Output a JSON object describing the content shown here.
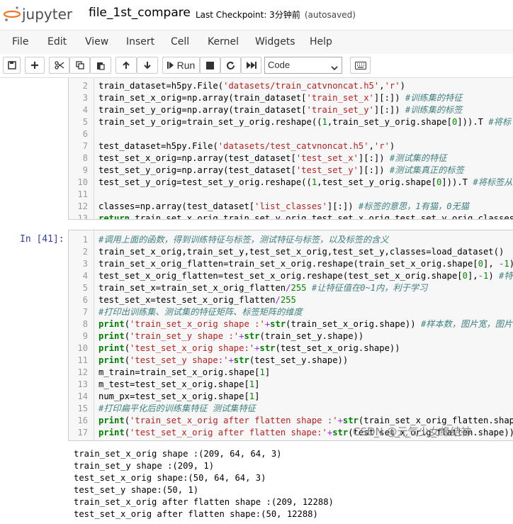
{
  "header": {
    "logo_text": "jupyter",
    "notebook_title": "file_1st_compare",
    "checkpoint_text": "Last Checkpoint: 3分钟前",
    "autosave_text": "(autosaved)"
  },
  "menu": [
    "File",
    "Edit",
    "View",
    "Insert",
    "Cell",
    "Kernel",
    "Widgets",
    "Help"
  ],
  "toolbar": {
    "run_label": "Run",
    "cell_type": "Code"
  },
  "cells": [
    {
      "prompt": "",
      "lines": [
        {
          "n": "2",
          "html": "    train_dataset=h5py.File(<span class='s'>'datasets/train_catvnoncat.h5'</span>,<span class='s'>'r'</span>)"
        },
        {
          "n": "3",
          "html": "    train_set_x_orig=np.array(train_dataset[<span class='s'>'train_set_x'</span>][:]) <span class='c'>#训练集的特征</span>"
        },
        {
          "n": "4",
          "html": "    train_set_y_orig=np.array(train_dataset[<span class='s'>'train_set_y'</span>][:]) <span class='c'>#训练集的标签</span>"
        },
        {
          "n": "5",
          "html": "    train_set_y_orig=train_set_y_orig.reshape((<span class='n'>1</span>,train_set_y_orig.shape[<span class='n'>0</span>])).T <span class='c'>#将标</span>"
        },
        {
          "n": "6",
          "html": ""
        },
        {
          "n": "7",
          "html": "    test_dataset=h5py.File(<span class='s'>'datasets/test_catvnoncat.h5'</span>,<span class='s'>'r'</span>)"
        },
        {
          "n": "8",
          "html": "    test_set_x_orig=np.array(test_dataset[<span class='s'>'test_set_x'</span>][:]) <span class='c'>#测试集的特征</span>"
        },
        {
          "n": "9",
          "html": "    test_set_y_orig=np.array(test_dataset[<span class='s'>'test_set_y'</span>][:]) <span class='c'>#测试集真正的标签</span>"
        },
        {
          "n": "10",
          "html": "    test_set_y_orig=test_set_y_orig.reshape((<span class='n'>1</span>,test_set_y_orig.shape[<span class='n'>0</span>])).T <span class='c'>#将标签从</span>"
        },
        {
          "n": "11",
          "html": ""
        },
        {
          "n": "12",
          "html": "    classes=np.array(test_dataset[<span class='s'>'list_classes'</span>][:]) <span class='c'>#标签的意思，1有猫，0无猫</span>"
        },
        {
          "n": "13",
          "html": "    <span class='k'>return</span> train_set_x_orig,train_set_y_orig,test_set_x_orig,test_set_y_orig,classes"
        }
      ]
    },
    {
      "prompt": "In  [41]:",
      "lines": [
        {
          "n": "1",
          "html": "<span class='c'>#调用上面的函数，得到训练特征与标签，测试特征与标签，以及标签的含义</span>"
        },
        {
          "n": "2",
          "html": "train_set_x_orig,train_set_y,test_set_x_orig,test_set_y,classes=load_dataset()"
        },
        {
          "n": "3",
          "html": "train_set_x_orig_flatten=train_set_x_orig.reshape(train_set_x_orig.shape[<span class='n'>0</span>], <span class='o'>-</span><span class='n'>1</span>) <span class='c'>#将</span>"
        },
        {
          "n": "4",
          "html": "test_set_x_orig_flatten=test_set_x_orig.reshape(test_set_x_orig.shape[<span class='n'>0</span>],<span class='o'>-</span><span class='n'>1</span>) <span class='c'>#特征扁</span>"
        },
        {
          "n": "5",
          "html": "train_set_x=train_set_x_orig_flatten<span class='o'>/</span><span class='n'>255</span> <span class='c'>#让特征值在0~1内，利于学习</span>"
        },
        {
          "n": "6",
          "html": "test_set_x=test_set_x_orig_flatten<span class='o'>/</span><span class='n'>255</span>"
        },
        {
          "n": "7",
          "html": "<span class='c'>#打印出训练集、测试集的特征矩阵、标签矩阵的维度</span>"
        },
        {
          "n": "8",
          "html": "<span class='k'>print</span>(<span class='s'>'train_set_x_orig shape :'</span><span class='o'>+</span><span class='k'>str</span>(train_set_x_orig.shape)) <span class='c'>#样本数，图片宽，图片长</span>"
        },
        {
          "n": "9",
          "html": "<span class='k'>print</span>(<span class='s'>'train_set_y shape :'</span><span class='o'>+</span><span class='k'>str</span>(train_set_y.shape))"
        },
        {
          "n": "10",
          "html": "<span class='k'>print</span>(<span class='s'>'test_set_x_orig shape:'</span><span class='o'>+</span><span class='k'>str</span>(test_set_x_orig.shape))"
        },
        {
          "n": "11",
          "html": "<span class='k'>print</span>(<span class='s'>'test_set_y shape:'</span><span class='o'>+</span><span class='k'>str</span>(test_set_y.shape))"
        },
        {
          "n": "12",
          "html": "m_train=train_set_x_orig.shape[<span class='n'>1</span>]"
        },
        {
          "n": "13",
          "html": "m_test=test_set_x_orig.shape[<span class='n'>1</span>]"
        },
        {
          "n": "14",
          "html": "num_px=test_set_x_orig.shape[<span class='n'>1</span>]"
        },
        {
          "n": "15",
          "html": "<span class='c'>#打印扁平化后的训练集特征 测试集特征</span>"
        },
        {
          "n": "16",
          "html": "<span class='k'>print</span>(<span class='s'>'train_set_x_orig after flatten shape :'</span><span class='o'>+</span><span class='k'>str</span>(train_set_x_orig_flatten.shape))"
        },
        {
          "n": "17",
          "html": "<span class='k'>print</span>(<span class='s'>'test_set_x_orig after flatten shape:'</span><span class='o'>+</span><span class='k'>str</span>(test_set_x_orig_flatten.shape))"
        }
      ]
    }
  ],
  "output_lines": [
    "train_set_x_orig shape :(209, 64, 64, 3)",
    "train_set_y shape :(209, 1)",
    "test_set_x_orig shape:(50, 64, 64, 3)",
    "test_set_y shape:(50, 1)",
    "train_set_x_orig after flatten shape :(209, 12288)",
    "test_set_x_orig after flatten shape:(50, 12288)"
  ],
  "watermark": "CSDN @元气少女缘结神",
  "colors": {
    "jupyter_orange": "#f37726",
    "prompt_blue": "#303f9f",
    "string_red": "#ba2121",
    "keyword_green": "#008000",
    "comment_teal": "#408080"
  }
}
